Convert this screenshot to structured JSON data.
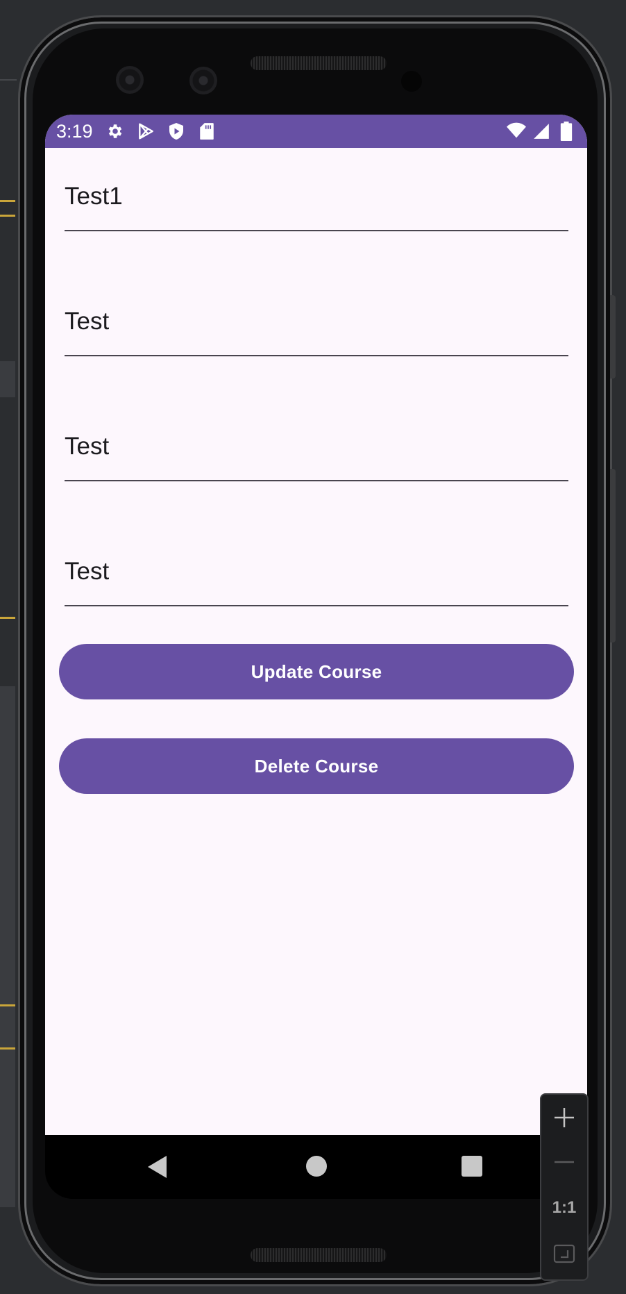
{
  "status_bar": {
    "time": "3:19",
    "background_color": "#6750a4",
    "left_icons": [
      "settings-icon",
      "play-store-icon",
      "shield-icon",
      "sd-card-icon"
    ],
    "right_icons": [
      "wifi-icon",
      "signal-icon",
      "battery-icon"
    ]
  },
  "form": {
    "fields": [
      {
        "value": "Test1"
      },
      {
        "value": "Test"
      },
      {
        "value": "Test"
      },
      {
        "value": "Test"
      }
    ],
    "update_button_label": "Update Course",
    "delete_button_label": "Delete Course",
    "button_color": "#6750a4"
  },
  "navigation_bar": {
    "icons": [
      "back-icon",
      "home-icon",
      "recents-icon"
    ]
  },
  "emulator_toolbar": {
    "zoom_in_icon": "plus-icon",
    "zoom_out_icon": "minus-icon",
    "actual_size_label": "1:1",
    "fit_icon": "fit-screen-icon"
  }
}
